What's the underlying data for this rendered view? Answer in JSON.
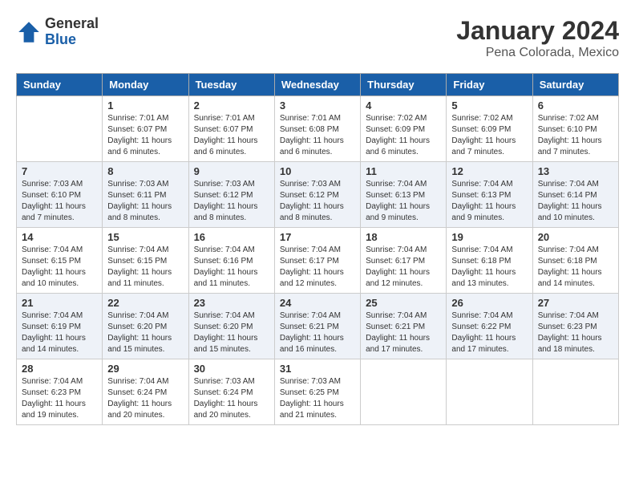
{
  "header": {
    "logo_general": "General",
    "logo_blue": "Blue",
    "month": "January 2024",
    "location": "Pena Colorada, Mexico"
  },
  "weekdays": [
    "Sunday",
    "Monday",
    "Tuesday",
    "Wednesday",
    "Thursday",
    "Friday",
    "Saturday"
  ],
  "weeks": [
    [
      {
        "day": "",
        "sunrise": "",
        "sunset": "",
        "daylight": ""
      },
      {
        "day": "1",
        "sunrise": "Sunrise: 7:01 AM",
        "sunset": "Sunset: 6:07 PM",
        "daylight": "Daylight: 11 hours and 6 minutes."
      },
      {
        "day": "2",
        "sunrise": "Sunrise: 7:01 AM",
        "sunset": "Sunset: 6:07 PM",
        "daylight": "Daylight: 11 hours and 6 minutes."
      },
      {
        "day": "3",
        "sunrise": "Sunrise: 7:01 AM",
        "sunset": "Sunset: 6:08 PM",
        "daylight": "Daylight: 11 hours and 6 minutes."
      },
      {
        "day": "4",
        "sunrise": "Sunrise: 7:02 AM",
        "sunset": "Sunset: 6:09 PM",
        "daylight": "Daylight: 11 hours and 6 minutes."
      },
      {
        "day": "5",
        "sunrise": "Sunrise: 7:02 AM",
        "sunset": "Sunset: 6:09 PM",
        "daylight": "Daylight: 11 hours and 7 minutes."
      },
      {
        "day": "6",
        "sunrise": "Sunrise: 7:02 AM",
        "sunset": "Sunset: 6:10 PM",
        "daylight": "Daylight: 11 hours and 7 minutes."
      }
    ],
    [
      {
        "day": "7",
        "sunrise": "Sunrise: 7:03 AM",
        "sunset": "Sunset: 6:10 PM",
        "daylight": "Daylight: 11 hours and 7 minutes."
      },
      {
        "day": "8",
        "sunrise": "Sunrise: 7:03 AM",
        "sunset": "Sunset: 6:11 PM",
        "daylight": "Daylight: 11 hours and 8 minutes."
      },
      {
        "day": "9",
        "sunrise": "Sunrise: 7:03 AM",
        "sunset": "Sunset: 6:12 PM",
        "daylight": "Daylight: 11 hours and 8 minutes."
      },
      {
        "day": "10",
        "sunrise": "Sunrise: 7:03 AM",
        "sunset": "Sunset: 6:12 PM",
        "daylight": "Daylight: 11 hours and 8 minutes."
      },
      {
        "day": "11",
        "sunrise": "Sunrise: 7:04 AM",
        "sunset": "Sunset: 6:13 PM",
        "daylight": "Daylight: 11 hours and 9 minutes."
      },
      {
        "day": "12",
        "sunrise": "Sunrise: 7:04 AM",
        "sunset": "Sunset: 6:13 PM",
        "daylight": "Daylight: 11 hours and 9 minutes."
      },
      {
        "day": "13",
        "sunrise": "Sunrise: 7:04 AM",
        "sunset": "Sunset: 6:14 PM",
        "daylight": "Daylight: 11 hours and 10 minutes."
      }
    ],
    [
      {
        "day": "14",
        "sunrise": "Sunrise: 7:04 AM",
        "sunset": "Sunset: 6:15 PM",
        "daylight": "Daylight: 11 hours and 10 minutes."
      },
      {
        "day": "15",
        "sunrise": "Sunrise: 7:04 AM",
        "sunset": "Sunset: 6:15 PM",
        "daylight": "Daylight: 11 hours and 11 minutes."
      },
      {
        "day": "16",
        "sunrise": "Sunrise: 7:04 AM",
        "sunset": "Sunset: 6:16 PM",
        "daylight": "Daylight: 11 hours and 11 minutes."
      },
      {
        "day": "17",
        "sunrise": "Sunrise: 7:04 AM",
        "sunset": "Sunset: 6:17 PM",
        "daylight": "Daylight: 11 hours and 12 minutes."
      },
      {
        "day": "18",
        "sunrise": "Sunrise: 7:04 AM",
        "sunset": "Sunset: 6:17 PM",
        "daylight": "Daylight: 11 hours and 12 minutes."
      },
      {
        "day": "19",
        "sunrise": "Sunrise: 7:04 AM",
        "sunset": "Sunset: 6:18 PM",
        "daylight": "Daylight: 11 hours and 13 minutes."
      },
      {
        "day": "20",
        "sunrise": "Sunrise: 7:04 AM",
        "sunset": "Sunset: 6:18 PM",
        "daylight": "Daylight: 11 hours and 14 minutes."
      }
    ],
    [
      {
        "day": "21",
        "sunrise": "Sunrise: 7:04 AM",
        "sunset": "Sunset: 6:19 PM",
        "daylight": "Daylight: 11 hours and 14 minutes."
      },
      {
        "day": "22",
        "sunrise": "Sunrise: 7:04 AM",
        "sunset": "Sunset: 6:20 PM",
        "daylight": "Daylight: 11 hours and 15 minutes."
      },
      {
        "day": "23",
        "sunrise": "Sunrise: 7:04 AM",
        "sunset": "Sunset: 6:20 PM",
        "daylight": "Daylight: 11 hours and 15 minutes."
      },
      {
        "day": "24",
        "sunrise": "Sunrise: 7:04 AM",
        "sunset": "Sunset: 6:21 PM",
        "daylight": "Daylight: 11 hours and 16 minutes."
      },
      {
        "day": "25",
        "sunrise": "Sunrise: 7:04 AM",
        "sunset": "Sunset: 6:21 PM",
        "daylight": "Daylight: 11 hours and 17 minutes."
      },
      {
        "day": "26",
        "sunrise": "Sunrise: 7:04 AM",
        "sunset": "Sunset: 6:22 PM",
        "daylight": "Daylight: 11 hours and 17 minutes."
      },
      {
        "day": "27",
        "sunrise": "Sunrise: 7:04 AM",
        "sunset": "Sunset: 6:23 PM",
        "daylight": "Daylight: 11 hours and 18 minutes."
      }
    ],
    [
      {
        "day": "28",
        "sunrise": "Sunrise: 7:04 AM",
        "sunset": "Sunset: 6:23 PM",
        "daylight": "Daylight: 11 hours and 19 minutes."
      },
      {
        "day": "29",
        "sunrise": "Sunrise: 7:04 AM",
        "sunset": "Sunset: 6:24 PM",
        "daylight": "Daylight: 11 hours and 20 minutes."
      },
      {
        "day": "30",
        "sunrise": "Sunrise: 7:03 AM",
        "sunset": "Sunset: 6:24 PM",
        "daylight": "Daylight: 11 hours and 20 minutes."
      },
      {
        "day": "31",
        "sunrise": "Sunrise: 7:03 AM",
        "sunset": "Sunset: 6:25 PM",
        "daylight": "Daylight: 11 hours and 21 minutes."
      },
      {
        "day": "",
        "sunrise": "",
        "sunset": "",
        "daylight": ""
      },
      {
        "day": "",
        "sunrise": "",
        "sunset": "",
        "daylight": ""
      },
      {
        "day": "",
        "sunrise": "",
        "sunset": "",
        "daylight": ""
      }
    ]
  ]
}
